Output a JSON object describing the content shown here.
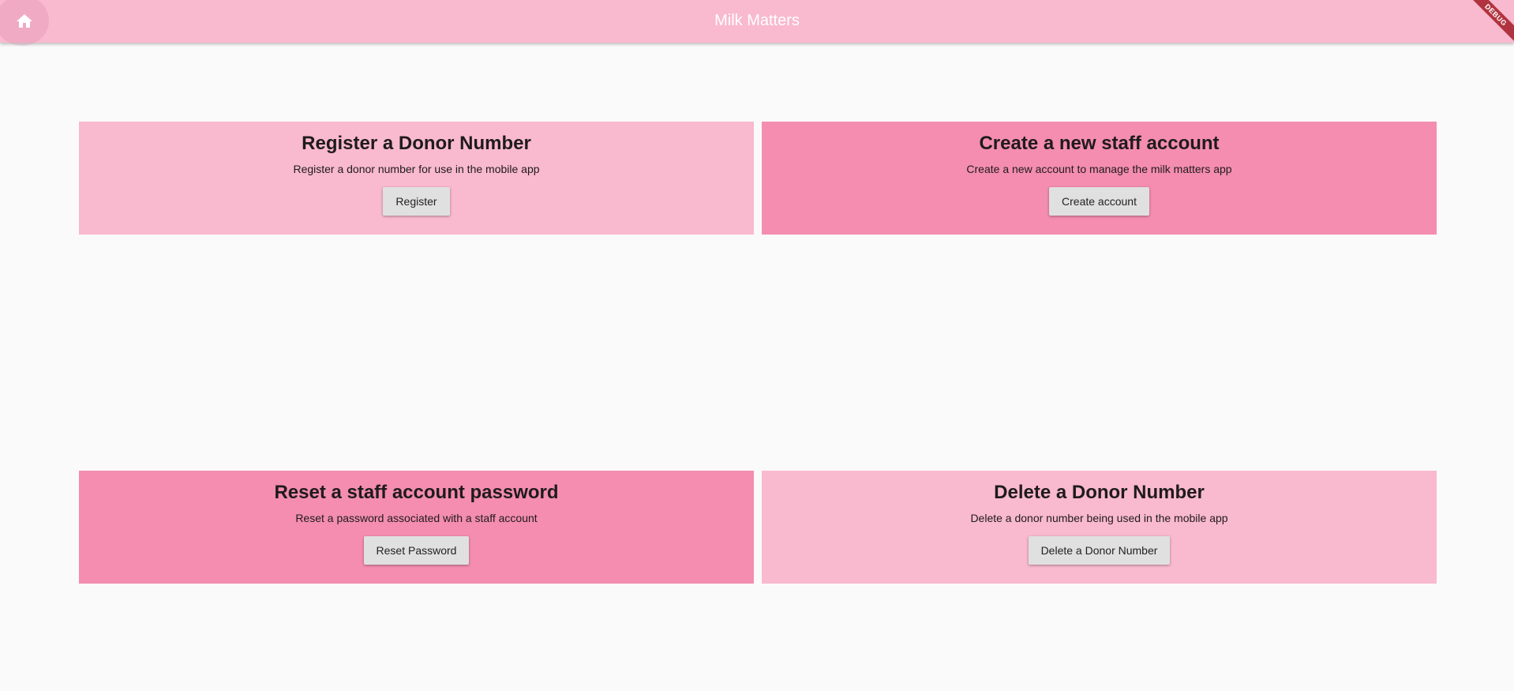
{
  "appbar": {
    "title": "Milk Matters",
    "home_icon": "home-icon",
    "debug_label": "DEBUG",
    "color": "#f9b9cf"
  },
  "cards": [
    {
      "title": "Register a Donor Number",
      "description": "Register a donor number for use in the mobile app",
      "button": "Register",
      "color": "#f9b9cf"
    },
    {
      "title": "Create a new staff account",
      "description": "Create a new account to manage the milk matters app",
      "button": "Create account",
      "color": "#f48db0"
    },
    {
      "title": "Reset a staff account password",
      "description": "Reset a password associated with a staff account",
      "button": "Reset Password",
      "color": "#f48db0"
    },
    {
      "title": "Delete a Donor Number",
      "description": "Delete a donor number being used in the mobile app",
      "button": "Delete a Donor Number",
      "color": "#f9b9cf"
    }
  ]
}
